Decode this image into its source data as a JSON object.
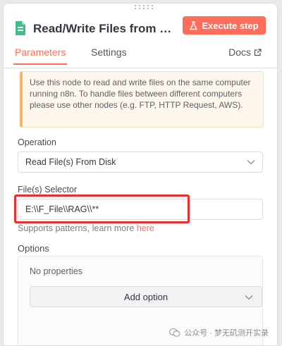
{
  "node": {
    "title": "Read/Write Files from Disk",
    "execute_label": "Execute step"
  },
  "tabs": {
    "parameters": "Parameters",
    "settings": "Settings",
    "docs": "Docs"
  },
  "notice": {
    "text": "Use this node to read and write files on the same computer running n8n. To handle files between different computers please use other nodes (e.g. FTP, HTTP Request, AWS)."
  },
  "operation": {
    "label": "Operation",
    "value": "Read File(s) From Disk"
  },
  "file_selector": {
    "label": "File(s) Selector",
    "value": "E:\\\\F_File\\\\RAG\\\\**",
    "hint_prefix": "Supports patterns, learn more",
    "hint_link": "here"
  },
  "options": {
    "label": "Options",
    "empty_text": "No properties",
    "add_label": "Add option"
  },
  "watermark": {
    "text": "公众号 · 梦无矶测开实录"
  },
  "colors": {
    "accent": "#ff6d5a",
    "notice_border": "#f7b565",
    "highlight": "#e8312f"
  }
}
